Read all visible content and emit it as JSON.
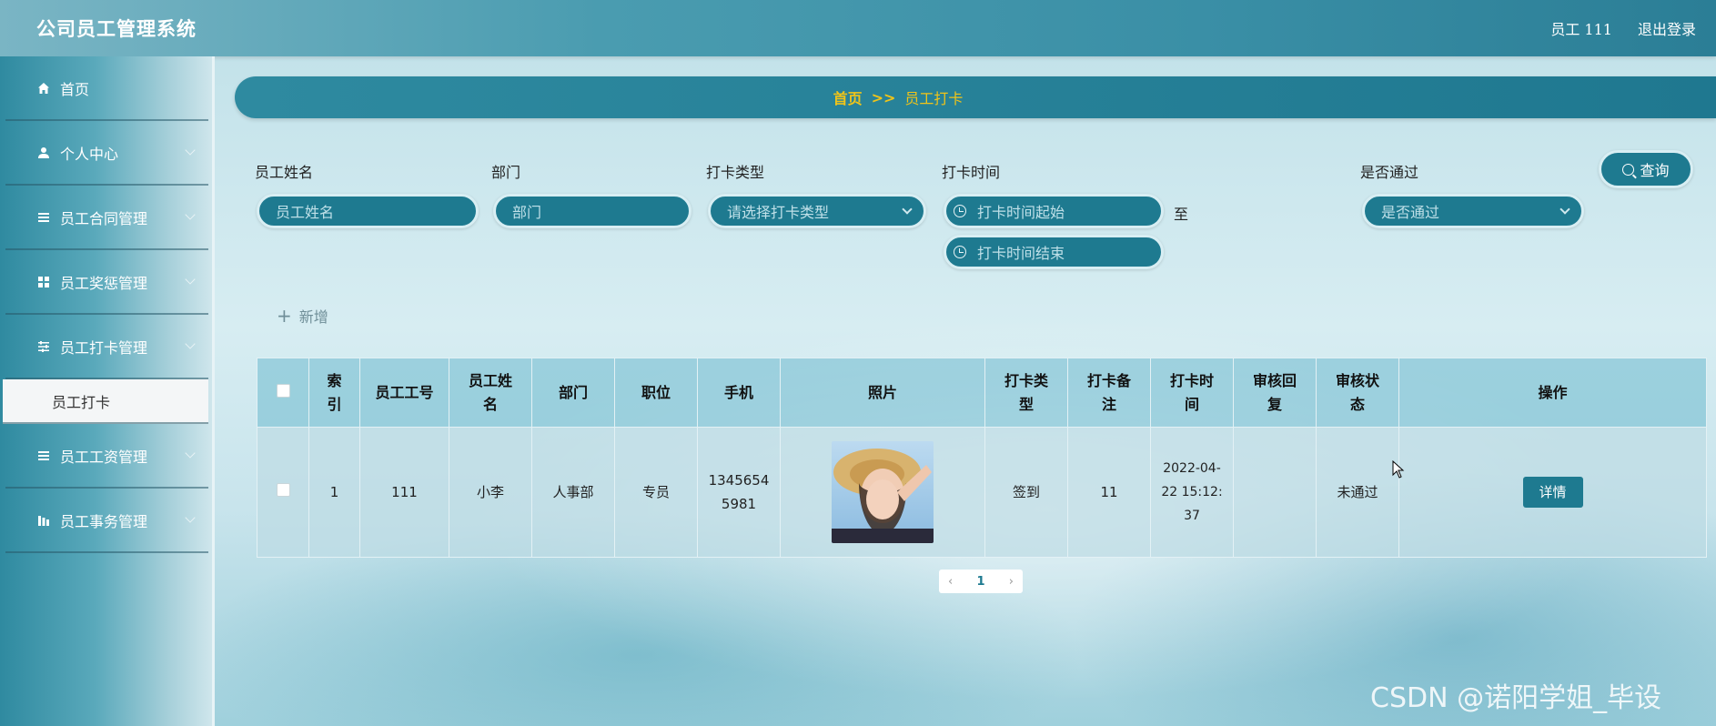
{
  "header": {
    "title": "公司员工管理系统",
    "user": "员工 111",
    "logout": "退出登录"
  },
  "sidebar": {
    "items": [
      {
        "label": "首页",
        "icon": "home-icon"
      },
      {
        "label": "个人中心",
        "icon": "user-icon"
      },
      {
        "label": "员工合同管理",
        "icon": "list-icon"
      },
      {
        "label": "员工奖惩管理",
        "icon": "grid-icon"
      },
      {
        "label": "员工打卡管理",
        "icon": "sliders-icon"
      },
      {
        "label": "员工工资管理",
        "icon": "list-icon"
      },
      {
        "label": "员工事务管理",
        "icon": "chart-icon"
      }
    ],
    "active_sub": "员工打卡"
  },
  "breadcrumb": {
    "home": "首页",
    "separator": ">>",
    "current": "员工打卡"
  },
  "filters": {
    "name": {
      "label": "员工姓名",
      "placeholder": "员工姓名"
    },
    "dept": {
      "label": "部门",
      "placeholder": "部门"
    },
    "type": {
      "label": "打卡类型",
      "placeholder": "请选择打卡类型"
    },
    "time": {
      "label": "打卡时间",
      "start_placeholder": "打卡时间起始",
      "end_placeholder": "打卡时间结束",
      "to": "至"
    },
    "passed": {
      "label": "是否通过",
      "placeholder": "是否通过"
    },
    "search_label": "查询"
  },
  "add_label": "新增",
  "table": {
    "headers": [
      "索引",
      "员工工号",
      "员工姓名",
      "部门",
      "职位",
      "手机",
      "照片",
      "打卡类型",
      "打卡备注",
      "打卡时间",
      "审核回复",
      "审核状态",
      "操作"
    ],
    "rows": [
      {
        "index": "1",
        "emp_no": "111",
        "name": "小李",
        "dept": "人事部",
        "position": "专员",
        "phone": "13456545981",
        "type": "签到",
        "remark": "11",
        "time": "2022-04-22 15:12:37",
        "reply": "",
        "status": "未通过",
        "action": "详情"
      }
    ]
  },
  "pagination": {
    "prev": "‹",
    "page": "1",
    "next": "›"
  },
  "watermark": "CSDN @诺阳学姐_毕设",
  "colors": {
    "accent": "#1e7a90",
    "crumb": "#f0c419"
  }
}
